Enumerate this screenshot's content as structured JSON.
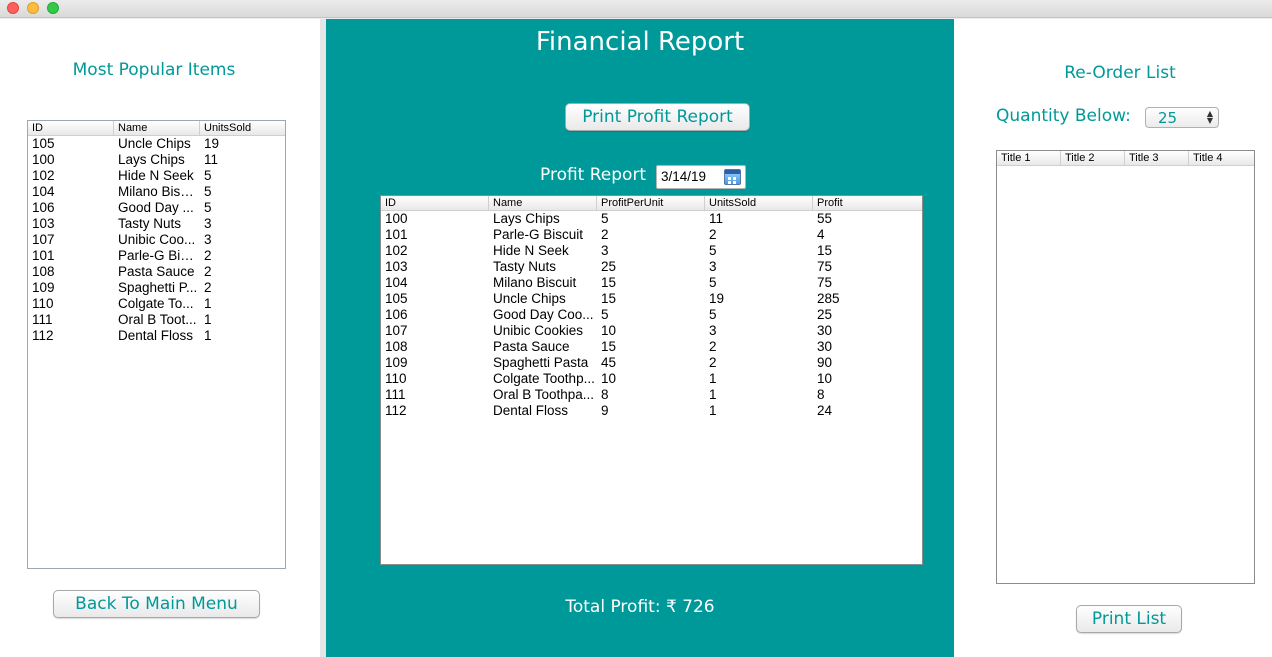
{
  "window": {
    "controls": [
      "close",
      "minimize",
      "zoom"
    ]
  },
  "left": {
    "heading": "Most Popular Items",
    "table": {
      "columns": [
        "ID",
        "Name",
        "UnitsSold"
      ],
      "rows": [
        [
          "105",
          "Uncle Chips",
          "19"
        ],
        [
          "100",
          "Lays Chips",
          "11"
        ],
        [
          "102",
          "Hide N Seek",
          "5"
        ],
        [
          "104",
          "Milano Biscuit",
          "5"
        ],
        [
          "106",
          "Good Day ...",
          "5"
        ],
        [
          "103",
          "Tasty Nuts",
          "3"
        ],
        [
          "107",
          "Unibic Coo...",
          "3"
        ],
        [
          "101",
          "Parle-G Bisc...",
          "2"
        ],
        [
          "108",
          "Pasta Sauce",
          "2"
        ],
        [
          "109",
          "Spaghetti P...",
          "2"
        ],
        [
          "110",
          "Colgate To...",
          "1"
        ],
        [
          "111",
          "Oral B Toot...",
          "1"
        ],
        [
          "112",
          "Dental Floss",
          "1"
        ]
      ]
    },
    "back_button": "Back To Main Menu"
  },
  "center": {
    "title": "Financial Report",
    "print_button": "Print Profit Report",
    "profit_label": "Profit Report",
    "date": "3/14/19",
    "table": {
      "columns": [
        "ID",
        "Name",
        "ProfitPerUnit",
        "UnitsSold",
        "Profit"
      ],
      "rows": [
        [
          "100",
          "Lays Chips",
          "5",
          "11",
          "55"
        ],
        [
          "101",
          "Parle-G Biscuit",
          "2",
          "2",
          "4"
        ],
        [
          "102",
          "Hide N Seek",
          "3",
          "5",
          "15"
        ],
        [
          "103",
          "Tasty Nuts",
          "25",
          "3",
          "75"
        ],
        [
          "104",
          "Milano Biscuit",
          "15",
          "5",
          "75"
        ],
        [
          "105",
          "Uncle Chips",
          "15",
          "19",
          "285"
        ],
        [
          "106",
          "Good Day Coo...",
          "5",
          "5",
          "25"
        ],
        [
          "107",
          "Unibic Cookies",
          "10",
          "3",
          "30"
        ],
        [
          "108",
          "Pasta Sauce",
          "15",
          "2",
          "30"
        ],
        [
          "109",
          "Spaghetti Pasta",
          "45",
          "2",
          "90"
        ],
        [
          "110",
          "Colgate Toothp...",
          "10",
          "1",
          "10"
        ],
        [
          "111",
          "Oral B Toothpa...",
          "8",
          "1",
          "8"
        ],
        [
          "112",
          "Dental Floss",
          "9",
          "1",
          "24"
        ]
      ]
    },
    "total_profit": "Total Profit: ₹ 726"
  },
  "right": {
    "heading": "Re-Order List",
    "quantity_label": "Quantity Below:",
    "quantity_value": "25",
    "table": {
      "columns": [
        "Title 1",
        "Title 2",
        "Title 3",
        "Title 4"
      ],
      "rows": []
    },
    "print_button": "Print List"
  },
  "colors": {
    "accent": "#009999",
    "panel": "#ffffff",
    "text_on_accent": "#ffffff"
  }
}
